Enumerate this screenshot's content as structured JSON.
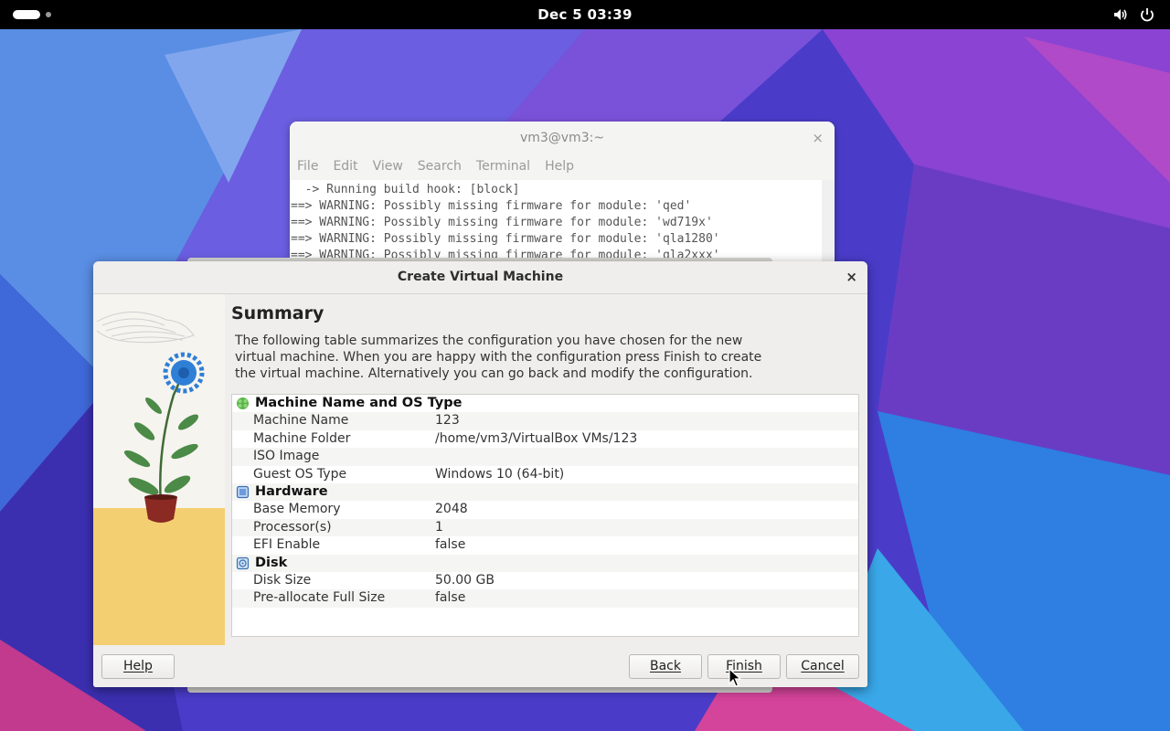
{
  "topbar": {
    "clock": "Dec 5  03:39",
    "icons": [
      "activities-icon",
      "volume-icon",
      "power-icon"
    ]
  },
  "terminal": {
    "title": "vm3@vm3:~",
    "close_glyph": "×",
    "menu": [
      "File",
      "Edit",
      "View",
      "Search",
      "Terminal",
      "Help"
    ],
    "lines": [
      "  -> Running build hook: [block]",
      "==> WARNING: Possibly missing firmware for module: 'qed'",
      "==> WARNING: Possibly missing firmware for module: 'wd719x'",
      "==> WARNING: Possibly missing firmware for module: 'qla1280'",
      "==> WARNING: Possibly missing firmware for module: 'qla2xxx'"
    ]
  },
  "dialog": {
    "title": "Create Virtual Machine",
    "close_glyph": "×",
    "heading": "Summary",
    "description": "The following table summarizes the configuration you have chosen for the new virtual machine. When you are happy with the configuration press Finish to create the virtual machine. Alternatively you can go back and modify the configuration.",
    "sections": [
      {
        "title": "Machine Name and OS Type",
        "icon": "machine-os-icon",
        "rows": [
          {
            "key": "Machine Name",
            "value": "123"
          },
          {
            "key": "Machine Folder",
            "value": "/home/vm3/VirtualBox VMs/123"
          },
          {
            "key": "ISO Image",
            "value": ""
          },
          {
            "key": "Guest OS Type",
            "value": "Windows 10 (64-bit)"
          }
        ]
      },
      {
        "title": "Hardware",
        "icon": "hardware-chip-icon",
        "rows": [
          {
            "key": "Base Memory",
            "value": "2048"
          },
          {
            "key": "Processor(s)",
            "value": "1"
          },
          {
            "key": "EFI Enable",
            "value": "false"
          }
        ]
      },
      {
        "title": "Disk",
        "icon": "disk-icon",
        "rows": [
          {
            "key": "Disk Size",
            "value": "50.00 GB"
          },
          {
            "key": "Pre-allocate Full Size",
            "value": "false"
          }
        ]
      }
    ],
    "buttons": {
      "help": "Help",
      "back": "Back",
      "finish": "Finish",
      "cancel": "Cancel"
    }
  },
  "colors": {
    "topbar": "#000000",
    "dialog_bg": "#efeeec",
    "wallpaper_primary": "#4b3fd1",
    "wallpaper_secondary": "#2d8fe0"
  }
}
